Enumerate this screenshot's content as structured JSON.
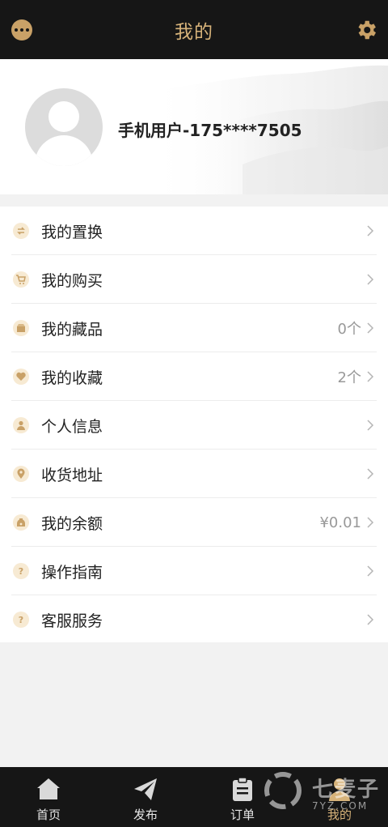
{
  "header": {
    "title": "我的"
  },
  "profile": {
    "username": "手机用户-175****7505"
  },
  "menu": [
    {
      "label": "我的置换",
      "value": "",
      "icon": "swap-icon"
    },
    {
      "label": "我的购买",
      "value": "",
      "icon": "cart-icon"
    },
    {
      "label": "我的藏品",
      "value": "0个",
      "icon": "collection-box-icon"
    },
    {
      "label": "我的收藏",
      "value": "2个",
      "icon": "heart-icon"
    },
    {
      "label": "个人信息",
      "value": "",
      "icon": "person-icon"
    },
    {
      "label": "收货地址",
      "value": "",
      "icon": "location-pin-icon"
    },
    {
      "label": "我的余额",
      "value": "¥0.01",
      "icon": "wallet-icon"
    },
    {
      "label": "操作指南",
      "value": "",
      "icon": "question-icon"
    },
    {
      "label": "客服服务",
      "value": "",
      "icon": "question-icon"
    }
  ],
  "tabbar": [
    {
      "label": "首页",
      "icon": "home-icon",
      "active": false
    },
    {
      "label": "发布",
      "icon": "paper-plane-icon",
      "active": false
    },
    {
      "label": "订单",
      "icon": "clipboard-icon",
      "active": false
    },
    {
      "label": "我的",
      "icon": "person-icon",
      "active": true
    }
  ],
  "watermark": {
    "text": "七麦子",
    "sub": "7YZ.COM"
  },
  "colors": {
    "accent": "#d7b37a",
    "bar": "#161616",
    "icon_bg": "#f7ead3"
  }
}
